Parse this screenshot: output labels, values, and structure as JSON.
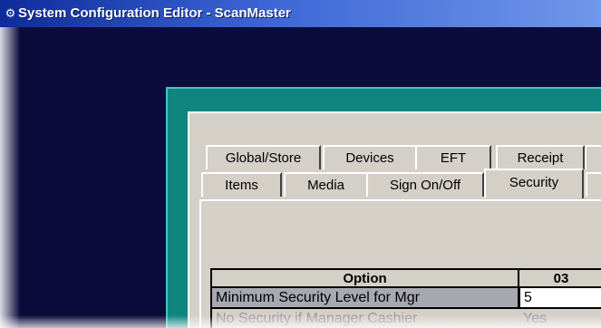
{
  "window": {
    "title": "System Configuration Editor - ScanMaster",
    "icon": "app-icon"
  },
  "tabs": {
    "row1": [
      "Global/Store",
      "Devices",
      "EFT",
      "Receipt"
    ],
    "row2": [
      "Items",
      "Media",
      "Sign On/Off",
      "Security"
    ],
    "active": "Security"
  },
  "grid": {
    "columns": [
      "Option",
      "03"
    ],
    "rows": [
      {
        "option": "Minimum Security Level for Mgr",
        "value": "5"
      },
      {
        "option": "No Security if Manager Cashier",
        "value": "Yes"
      }
    ]
  },
  "colors": {
    "desktop": "#0c0c3c",
    "titlebar_start": "#0e2b9a",
    "titlebar_end": "#6f97ea",
    "panel": "#10857f",
    "dialog": "#d4d0c8"
  }
}
